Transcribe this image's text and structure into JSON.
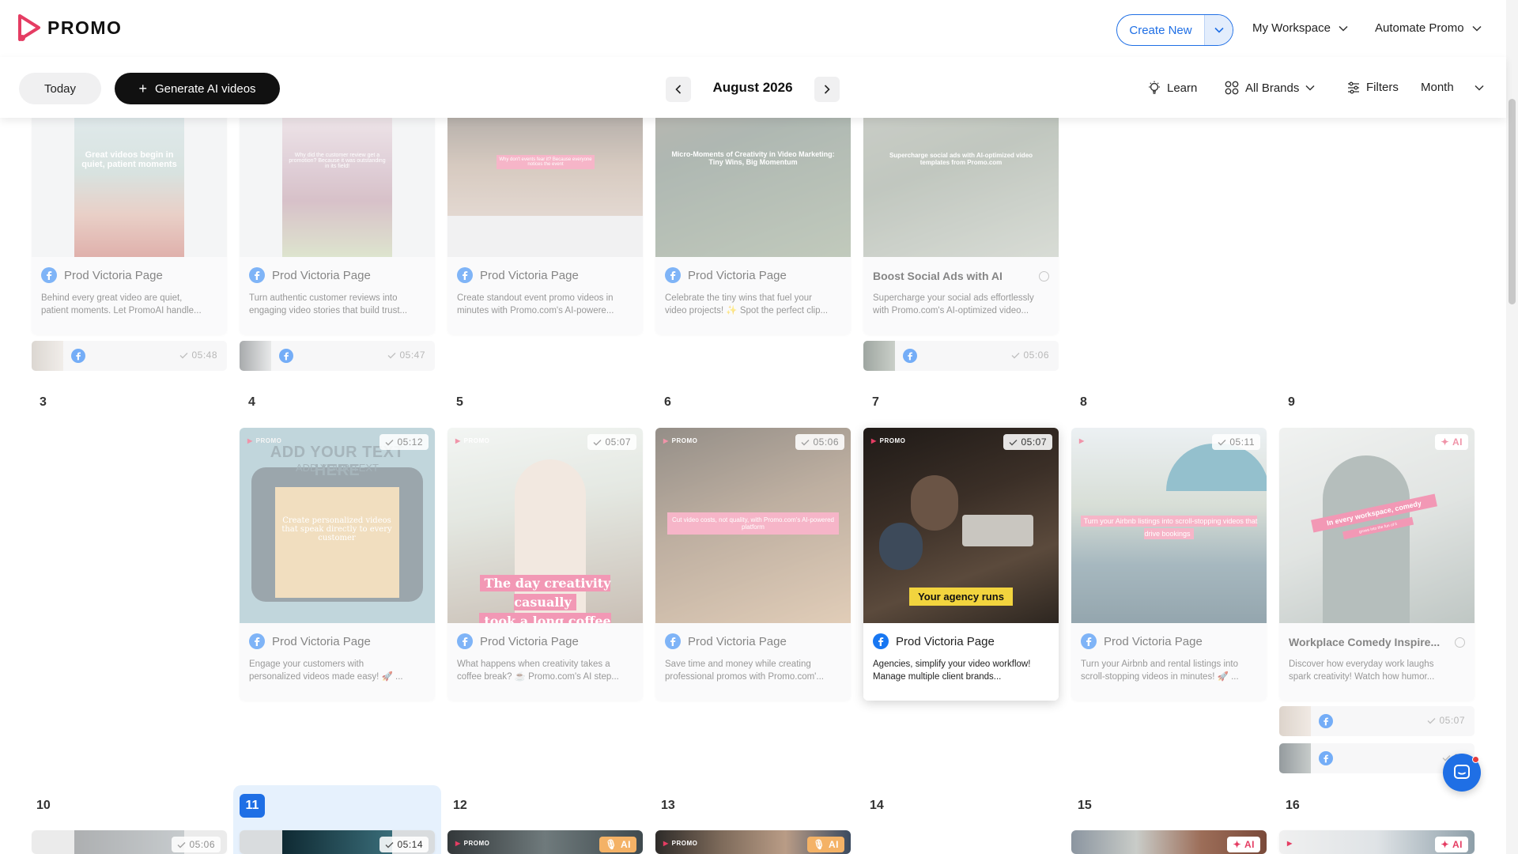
{
  "header": {
    "brand": "PROMO",
    "create_new": "Create New",
    "workspace": "My Workspace",
    "automate": "Automate Promo"
  },
  "toolbar": {
    "today": "Today",
    "generate": "Generate AI videos",
    "month_title": "August 2026",
    "learn": "Learn",
    "brands": "All Brands",
    "filters": "Filters",
    "view": "Month"
  },
  "week1": {
    "cards": [
      {
        "page": "Prod Victoria Page",
        "desc1": "Behind every great video are quiet,",
        "desc2": "patient moments. Let PromoAI handle..."
      },
      {
        "page": "Prod Victoria Page",
        "desc1": "Turn authentic customer reviews into",
        "desc2": "engaging video stories that build trust..."
      },
      {
        "page": "Prod Victoria Page",
        "desc1": "Create standout event promo videos in",
        "desc2": "minutes with Promo.com's AI-powere..."
      },
      {
        "page": "Prod Victoria Page",
        "desc1": "Celebrate the tiny wins that fuel your",
        "desc2": "video projects! ✨ Spot the perfect clip..."
      },
      {
        "title": "Boost Social Ads with AI",
        "desc1": "Supercharge your social ads effortlessly",
        "desc2": "with Promo.com's AI-optimized video..."
      }
    ],
    "captions": {
      "c1": "Great videos begin in quiet, patient moments",
      "c2": "Why did the customer review get a promotion? Because it was outstanding in its field!",
      "c3": "Why don't events fear it? Because everyone notices the event",
      "c4": "Micro-Moments of Creativity in Video Marketing: Tiny Wins, Big Momentum",
      "c5": "Supercharge social ads with AI-optimized video templates from Promo.com"
    },
    "mini": [
      {
        "time": "05:48"
      },
      {
        "time": "05:47"
      },
      {
        "time": "05:06"
      }
    ]
  },
  "week2": {
    "days": [
      "3",
      "4",
      "5",
      "6",
      "7",
      "8",
      "9"
    ],
    "cards": [
      {
        "time": "05:12",
        "page": "Prod Victoria Page",
        "desc1": "Engage your customers with",
        "desc2": "personalized videos made easy! 🚀 ..."
      },
      {
        "time": "05:07",
        "page": "Prod Victoria Page",
        "desc1": "What happens when creativity takes a",
        "desc2": "coffee break? ☕ Promo.com's AI step..."
      },
      {
        "time": "05:06",
        "page": "Prod Victoria Page",
        "desc1": "Save time and money while creating",
        "desc2": "professional promos with Promo.com'..."
      },
      {
        "time": "05:07",
        "page": "Prod Victoria Page",
        "desc1": "Agencies, simplify your video workflow!",
        "desc2": "Manage multiple client brands..."
      },
      {
        "time": "05:11",
        "page": "Prod Victoria Page",
        "desc1": "Turn your Airbnb and rental listings into",
        "desc2": "scroll-stopping videos in minutes! 🚀 ..."
      },
      {
        "badge": "AI",
        "title": "Workplace Comedy Inspire...",
        "desc1": "Discover how everyday work laughs",
        "desc2": "spark creativity! Watch how humor..."
      }
    ],
    "captions": {
      "add_text": "ADD YOUR TEXT HERE",
      "add_text_sub": "ADD YOUR TEXT",
      "personalized": "Create personalized videos that speak directly to every customer",
      "coffee_1": "The day creativity casually",
      "coffee_2": "took a long coffee break",
      "cut_costs": "Cut video costs, not quality, with Promo.com's AI-powered platform",
      "agency": "Your agency runs",
      "airbnb": "Turn your Airbnb listings into scroll-stopping videos that drive bookings",
      "comedy": "In every workspace, comedy",
      "comedy_sub": "grows into the fun of it"
    },
    "mini": [
      {
        "time": "05:07"
      },
      {
        "time": "07"
      }
    ],
    "logo_small": "PROMO"
  },
  "week3": {
    "days": [
      "10",
      "11",
      "12",
      "13",
      "14",
      "15",
      "16"
    ],
    "badges": [
      {
        "time": "05:06"
      },
      {
        "time": "05:14"
      },
      {
        "ai": "AI"
      },
      {
        "ai": "AI"
      },
      {
        "ai": "AI"
      },
      {
        "ai": "AI"
      }
    ]
  },
  "colors": {
    "accent": "#1f6fe5",
    "facebook": "#1877f2",
    "brand_red": "#e53d63"
  }
}
